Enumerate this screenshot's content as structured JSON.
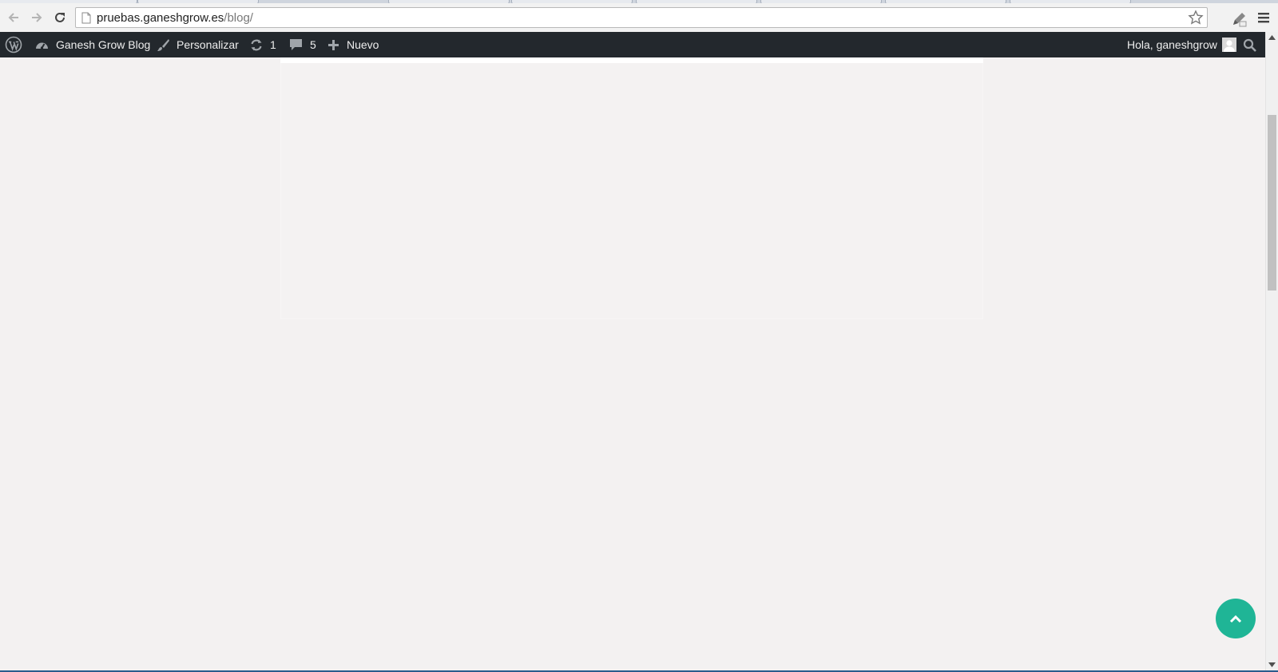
{
  "browser": {
    "url_host": "pruebas.ganeshgrow.es",
    "url_path": "/blog/"
  },
  "adminbar": {
    "site_name": "Ganesh Grow Blog",
    "customize": "Personalizar",
    "updates_count": "1",
    "comments_count": "5",
    "new_label": "Nuevo",
    "greeting": "Hola, ganeshgrow"
  },
  "icons": {
    "back": "arrow-left-icon",
    "forward": "arrow-right-icon",
    "reload": "reload-icon",
    "page": "page-icon",
    "bookmark": "star-icon",
    "extension": "pen-icon",
    "menu": "hamburger-icon",
    "wordpress": "wordpress-logo-icon",
    "dashboard": "dashboard-icon",
    "customize": "brush-icon",
    "updates": "refresh-icon",
    "comments": "comment-icon",
    "new": "plus-icon",
    "avatar": "avatar-icon",
    "search": "search-icon",
    "back_to_top": "chevron-up-icon"
  },
  "colors": {
    "adminbar_bg": "#23282d",
    "back_to_top_bg": "#1fb596",
    "page_bg": "#f3f1f1"
  }
}
